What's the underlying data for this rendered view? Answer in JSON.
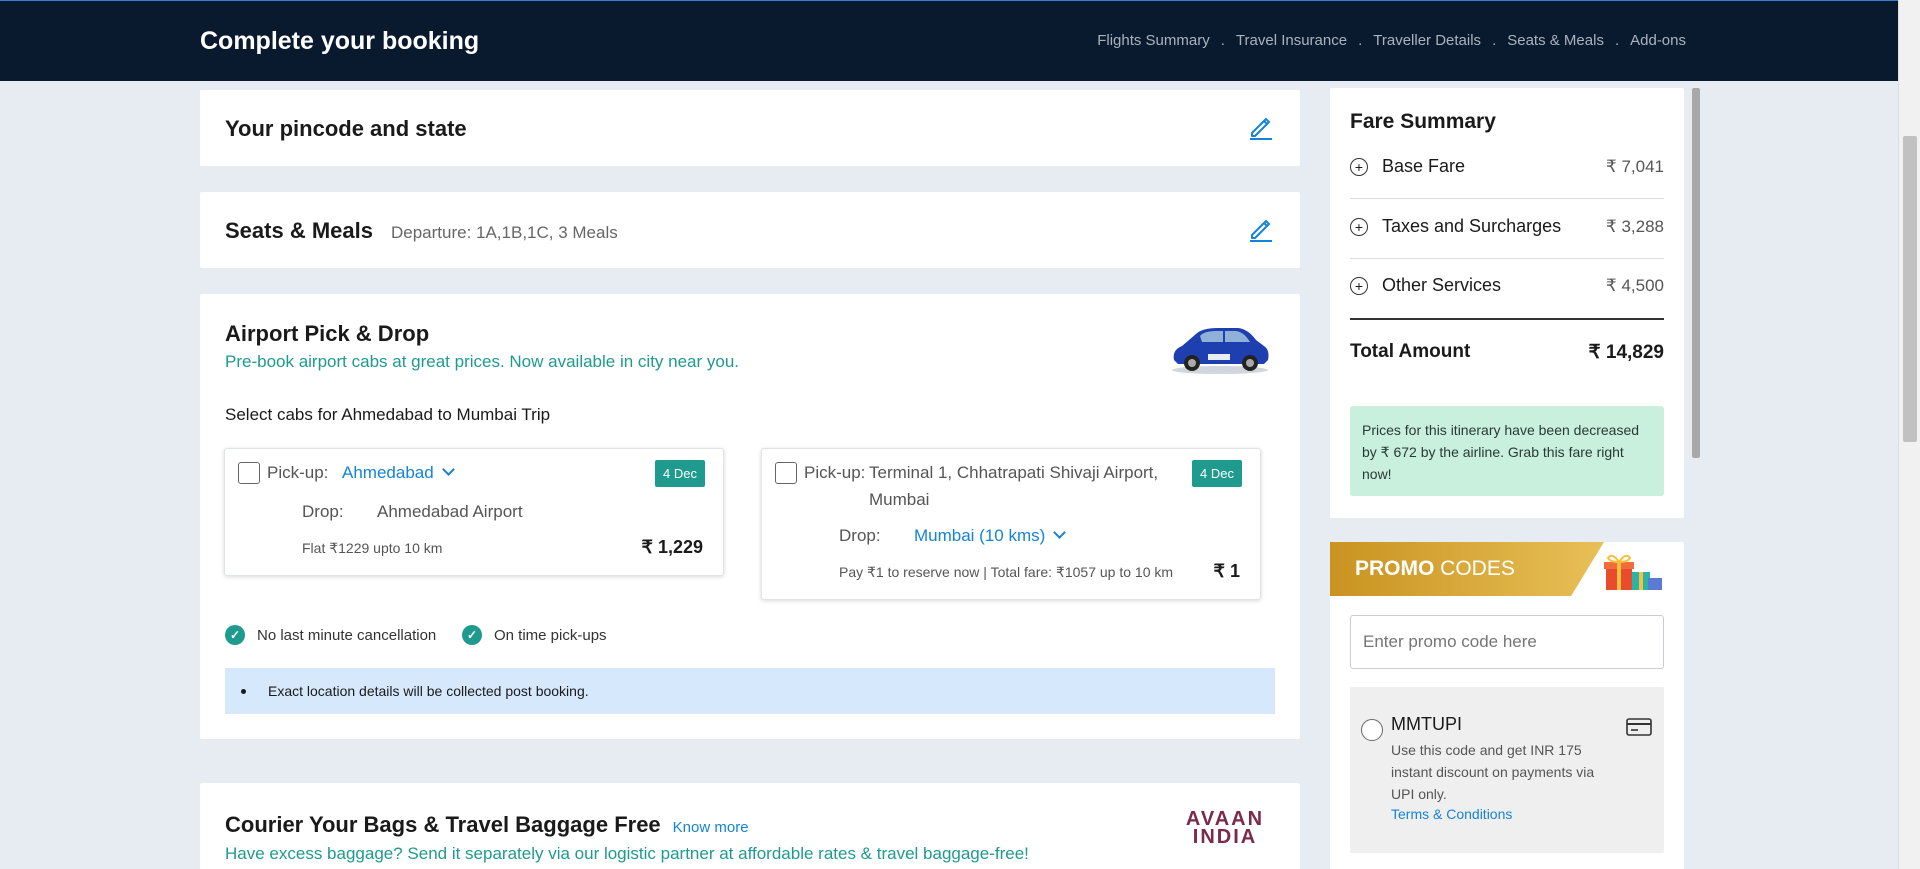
{
  "header": {
    "title": "Complete your booking",
    "steps": [
      "Flights Summary",
      "Travel Insurance",
      "Traveller Details",
      "Seats & Meals",
      "Add-ons"
    ],
    "separator": "."
  },
  "pincode": {
    "title": "Your pincode and state"
  },
  "seats_meals": {
    "title": "Seats & Meals",
    "detail": "Departure: 1A,1B,1C, 3 Meals"
  },
  "airport_cab": {
    "title": "Airport Pick & Drop",
    "subtitle": "Pre-book airport cabs at great prices. Now available in city near you.",
    "select_label": "Select cabs for Ahmedabad to Mumbai Trip",
    "cab1": {
      "pickup_label": "Pick-up:",
      "pickup_value": "Ahmedabad",
      "date": "4 Dec",
      "drop_label": "Drop:",
      "drop_value": "Ahmedabad Airport",
      "note": "Flat ₹1229 upto 10 km",
      "price": "₹ 1,229"
    },
    "cab2": {
      "pickup_label": "Pick-up:",
      "pickup_value_line1": "Terminal 1, Chhatrapati Shivaji Airport,",
      "pickup_value_line2": "Mumbai",
      "date": "4 Dec",
      "drop_label": "Drop:",
      "drop_value": "Mumbai (10 kms)",
      "note": "Pay ₹1 to reserve now | Total fare: ₹1057 up to 10 km",
      "price": "₹ 1"
    },
    "feature1": "No last minute cancellation",
    "feature2": "On time pick-ups",
    "info": "Exact location details will be collected post booking."
  },
  "courier": {
    "title": "Courier Your Bags & Travel Baggage Free",
    "link": "Know more",
    "subtitle": "Have excess baggage? Send it separately via our logistic partner at affordable rates & travel baggage-free!",
    "logo_line1": "AVAAN",
    "logo_line2": "INDIA"
  },
  "fare_summary": {
    "title": "Fare Summary",
    "rows": [
      {
        "label": "Base Fare",
        "amount": "₹ 7,041"
      },
      {
        "label": "Taxes and Surcharges",
        "amount": "₹ 3,288"
      },
      {
        "label": "Other Services",
        "amount": "₹ 4,500"
      }
    ],
    "total_label": "Total Amount",
    "total_amount": "₹ 14,829",
    "notice": "Prices for this itinerary have been decreased by ₹ 672 by the airline. Grab this fare right now!"
  },
  "promo": {
    "title_bold": "PROMO",
    "title_rest": " CODES",
    "input_placeholder": "Enter promo code here",
    "code": "MMTUPI",
    "description": "Use this code and get INR 175 instant discount on payments via UPI only.",
    "terms": "Terms & Conditions"
  },
  "colors": {
    "header_bg": "#0a1a2e",
    "teal": "#1f9a8f",
    "link_blue": "#1583d8",
    "notice_bg": "#c8f0dc",
    "info_bg": "#d6e8fb",
    "promo_gold": "#d9a52a"
  }
}
